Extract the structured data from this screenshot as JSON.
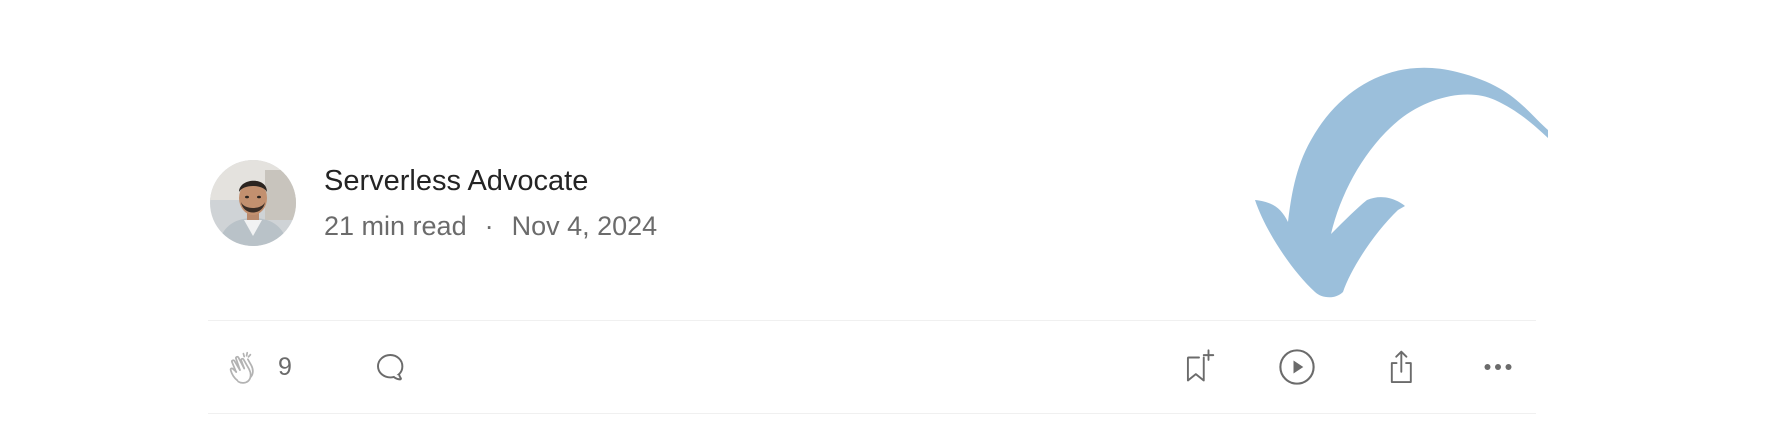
{
  "author": {
    "name": "Serverless Advocate",
    "read_time": "21 min read",
    "separator": "·",
    "date": "Nov 4, 2024"
  },
  "actions": {
    "clap_count": "9",
    "icons": [
      "clap-icon",
      "response-icon",
      "bookmark-add-icon",
      "play-icon",
      "share-icon",
      "more-icon"
    ]
  },
  "colors": {
    "text_primary": "#242424",
    "text_secondary": "#6b6b6b",
    "icon_gray": "#6b6b6b",
    "divider": "#f0f0f0",
    "annotation_arrow": "#9bbfdb"
  }
}
